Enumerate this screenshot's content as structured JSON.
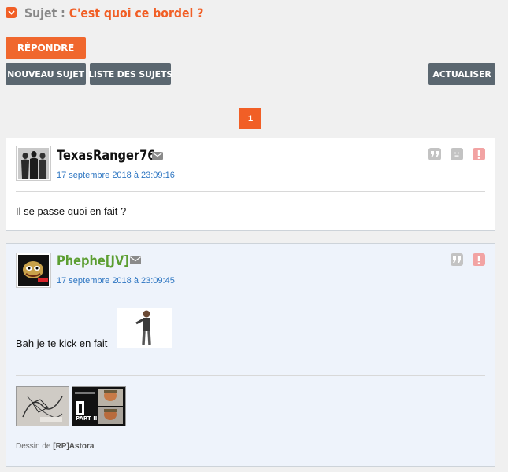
{
  "topic": {
    "prefix": "Sujet :",
    "title": "C'est quoi ce bordel ?"
  },
  "buttons": {
    "reply": "RÉPONDRE",
    "new_topic": "NOUVEAU SUJET",
    "topic_list": "LISTE DES SUJETS",
    "refresh": "ACTUALISER"
  },
  "pagination": {
    "current": "1"
  },
  "posts": [
    {
      "author": "TexasRanger76",
      "date": "17 septembre 2018 à 23:09:16",
      "text": "Il se passe quoi en fait ?",
      "actions": [
        "quote-icon",
        "report-face-icon",
        "alert-icon"
      ]
    },
    {
      "author": "Phephe[JV]",
      "date": "17 septembre 2018 à 23:09:45",
      "text": "Bah je te kick en fait",
      "actions": [
        "quote-icon",
        "alert-icon"
      ],
      "signature": {
        "credit_prefix": "Dessin de",
        "credit_author": "[RP]Astora",
        "image2_caption": "PART II"
      }
    }
  ],
  "colors": {
    "accent": "#f15f26",
    "button_grey": "#5b6770",
    "date_link": "#2b74c1",
    "author_green": "#5c9e32"
  }
}
